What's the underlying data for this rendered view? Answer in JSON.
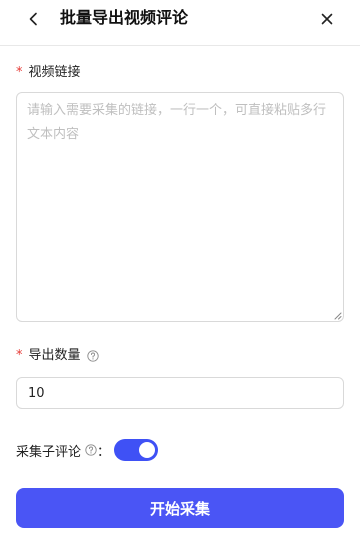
{
  "header": {
    "title": "批量导出视频评论",
    "back_icon": "chevron-left-icon",
    "close_icon": "close-icon"
  },
  "video_links": {
    "label": "视频链接",
    "required_mark": "*",
    "value": "",
    "placeholder": "请输入需要采集的链接，一行一个，可直接粘贴多行文本内容"
  },
  "export_count": {
    "label": "导出数量",
    "required_mark": "*",
    "help_icon": "question-circle-icon",
    "value": "10"
  },
  "collect_replies": {
    "label": "采集子评论",
    "help_icon": "question-circle-icon",
    "colon": "：",
    "enabled": true
  },
  "submit": {
    "label": "开始采集"
  },
  "colors": {
    "accent": "#4a55f5",
    "required": "#e53935",
    "switch_on": "#3f51f5"
  }
}
